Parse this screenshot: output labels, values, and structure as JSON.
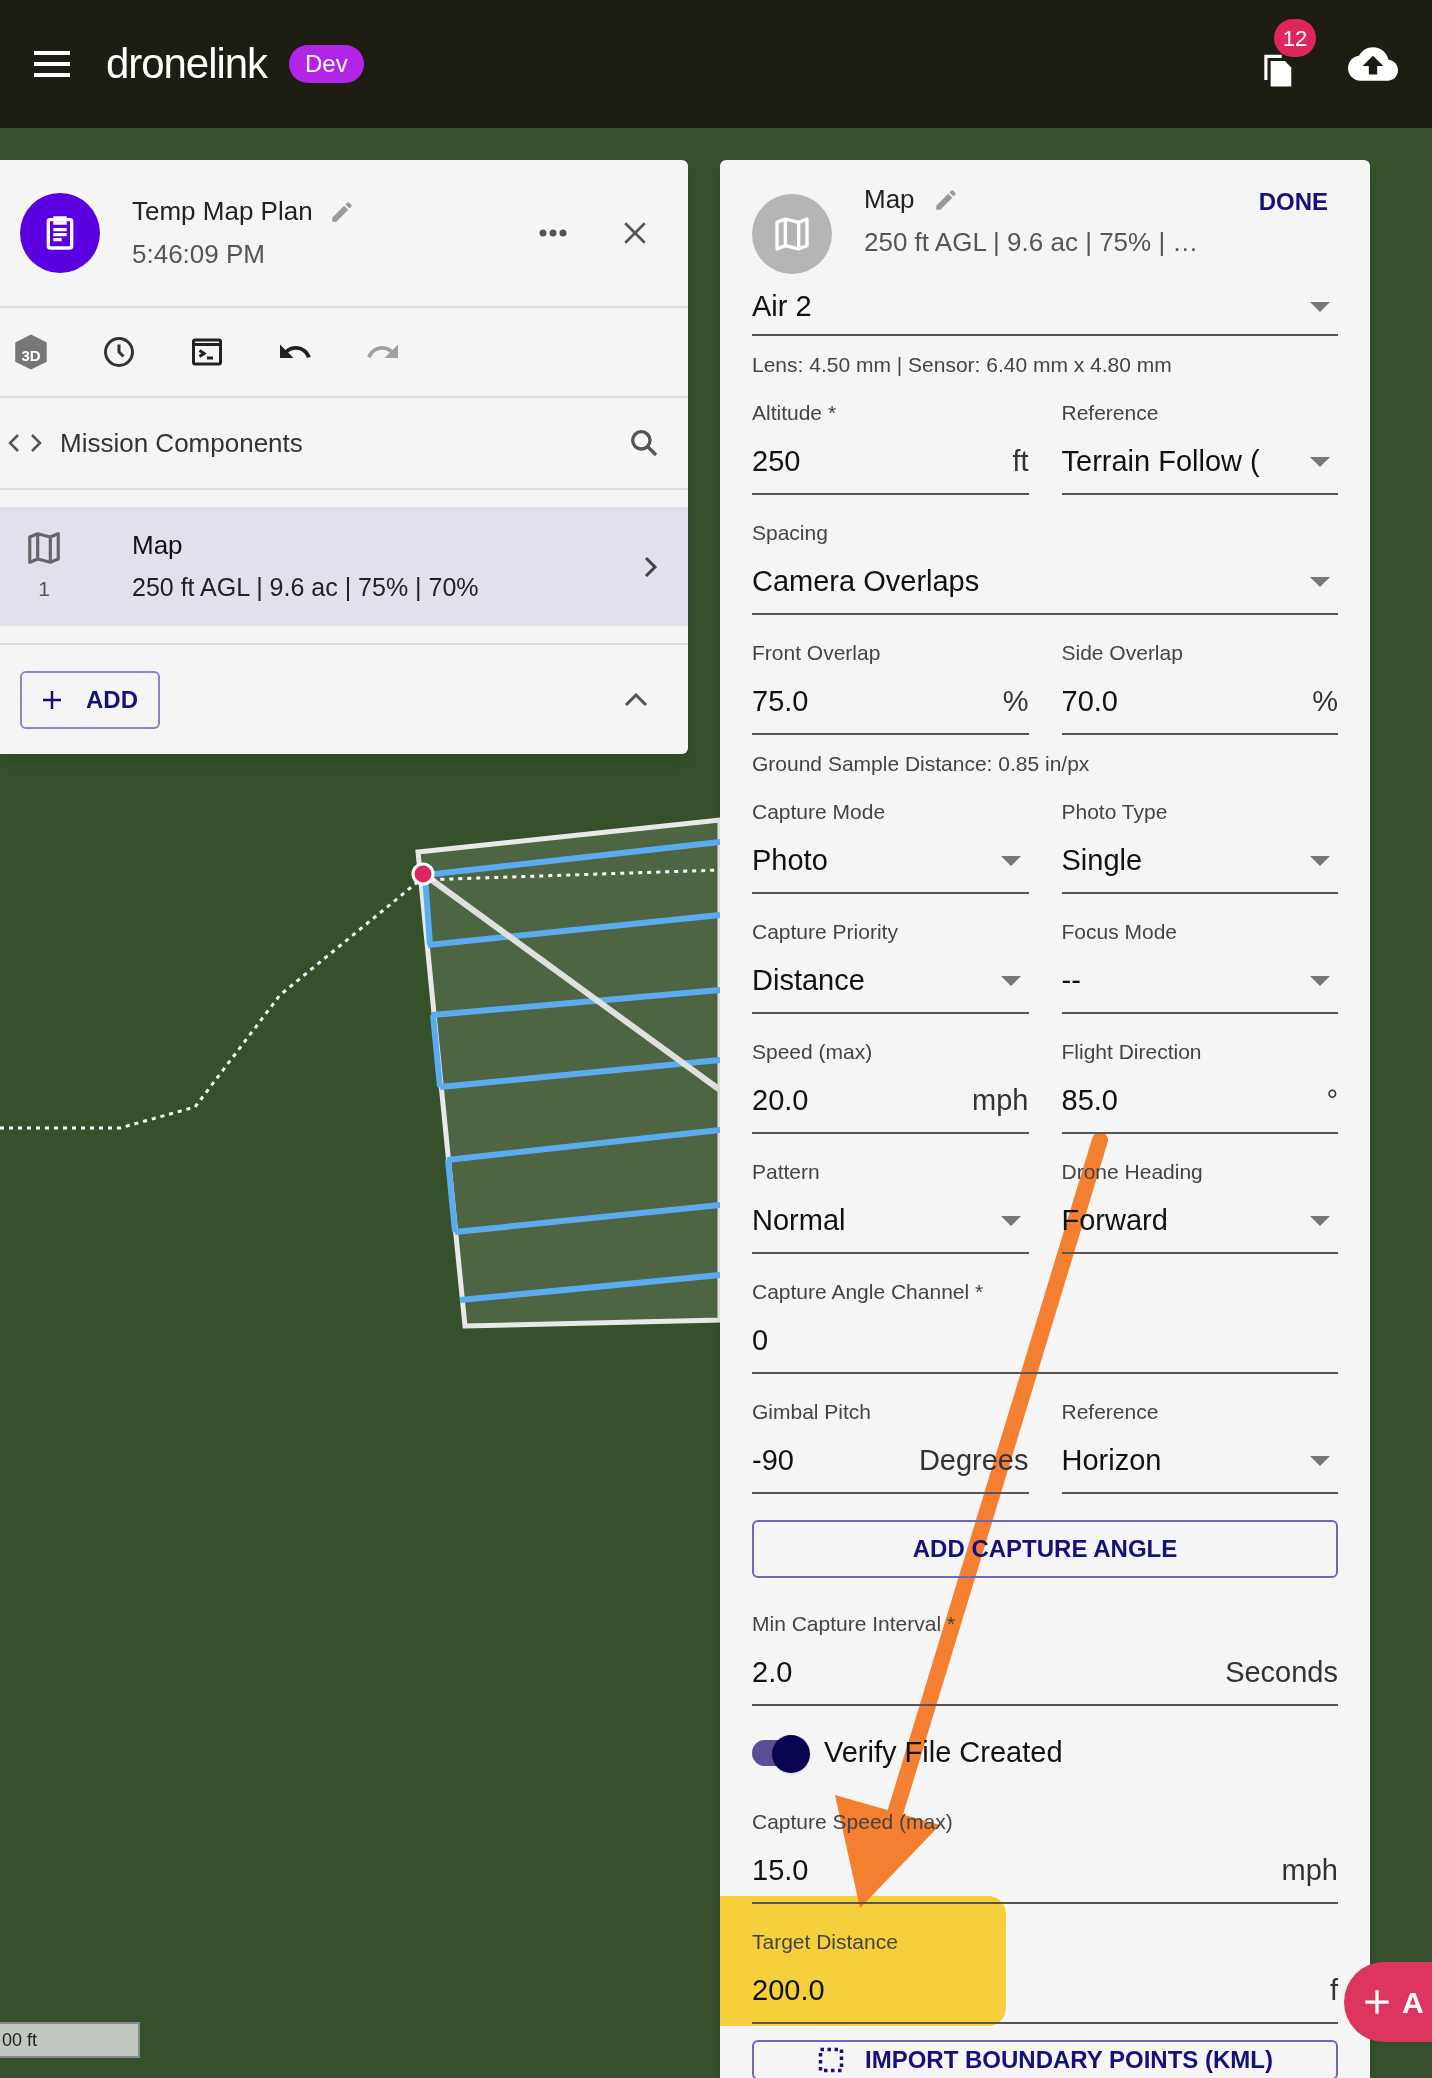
{
  "app_bar": {
    "logo": "dronelink",
    "env_badge": "Dev",
    "notification_count": "12"
  },
  "plan_panel": {
    "title": "Temp Map Plan",
    "subtitle": "5:46:09 PM",
    "toolbar": [
      {
        "kind": "cube",
        "label": "3D",
        "disabled": false
      },
      {
        "kind": "history",
        "disabled": false
      },
      {
        "kind": "console",
        "disabled": false
      },
      {
        "kind": "undo",
        "disabled": false
      },
      {
        "kind": "redo",
        "disabled": true
      }
    ],
    "section_title": "Mission Components",
    "components": [
      {
        "index": "1",
        "title": "Map",
        "summary": "250 ft AGL | 9.6 ac | 75% | 70%",
        "selected": true
      }
    ],
    "add_button": "ADD"
  },
  "component_panel": {
    "title": "Map",
    "subtitle": "250 ft AGL | 9.6 ac | 75% | …",
    "done_button": "DONE",
    "rows": [
      {
        "kind": "fields",
        "items": [
          {
            "kind": "select",
            "value": "Air 2"
          }
        ]
      },
      {
        "kind": "info",
        "text": "Lens: 4.50 mm | Sensor: 6.40 mm x 4.80 mm"
      },
      {
        "kind": "fields",
        "items": [
          {
            "kind": "input",
            "label": "Altitude *",
            "value": "250",
            "suffix": "ft"
          },
          {
            "kind": "select",
            "label": "Reference",
            "value": "Terrain Follow ("
          }
        ]
      },
      {
        "kind": "fields",
        "items": [
          {
            "kind": "select",
            "label": "Spacing",
            "value": "Camera Overlaps"
          }
        ]
      },
      {
        "kind": "fields",
        "items": [
          {
            "kind": "input",
            "label": "Front Overlap",
            "value": "75.0",
            "suffix": "%"
          },
          {
            "kind": "input",
            "label": "Side Overlap",
            "value": "70.0",
            "suffix": "%"
          }
        ]
      },
      {
        "kind": "info",
        "text": "Ground Sample Distance: 0.85 in/px"
      },
      {
        "kind": "fields",
        "items": [
          {
            "kind": "select",
            "label": "Capture Mode",
            "value": "Photo"
          },
          {
            "kind": "select",
            "label": "Photo Type",
            "value": "Single"
          }
        ]
      },
      {
        "kind": "fields",
        "items": [
          {
            "kind": "select",
            "label": "Capture Priority",
            "value": "Distance"
          },
          {
            "kind": "select",
            "label": "Focus Mode",
            "value": "--"
          }
        ]
      },
      {
        "kind": "fields",
        "items": [
          {
            "kind": "input",
            "label": "Speed (max)",
            "value": "20.0",
            "suffix": "mph"
          },
          {
            "kind": "input",
            "label": "Flight Direction",
            "value": "85.0",
            "suffix": "°"
          }
        ]
      },
      {
        "kind": "fields",
        "items": [
          {
            "kind": "select",
            "label": "Pattern",
            "value": "Normal"
          },
          {
            "kind": "select",
            "label": "Drone Heading",
            "value": "Forward"
          }
        ]
      },
      {
        "kind": "fields",
        "items": [
          {
            "kind": "input",
            "label": "Capture Angle Channel *",
            "value": "0"
          }
        ]
      },
      {
        "kind": "fields",
        "items": [
          {
            "kind": "input",
            "label": "Gimbal Pitch",
            "value": "-90",
            "suffix": "Degrees"
          },
          {
            "kind": "select",
            "label": "Reference",
            "value": "Horizon"
          }
        ]
      },
      {
        "kind": "button",
        "text": "ADD CAPTURE ANGLE"
      },
      {
        "kind": "fields",
        "items": [
          {
            "kind": "input",
            "label": "Min Capture Interval *",
            "value": "2.0",
            "suffix": "Seconds"
          }
        ]
      },
      {
        "kind": "toggle",
        "label": "Verify File Created",
        "on": true
      },
      {
        "kind": "fields",
        "items": [
          {
            "kind": "input",
            "label": "Capture Speed (max)",
            "value": "15.0",
            "suffix": "mph"
          }
        ]
      },
      {
        "kind": "fields",
        "items": [
          {
            "kind": "input",
            "label": "Target Distance",
            "value": "200.0",
            "suffix": "f"
          }
        ]
      },
      {
        "kind": "import_button",
        "text": "IMPORT BOUNDARY POINTS (KML)"
      }
    ]
  },
  "fab": {
    "label": "A"
  },
  "scale_bar": "00 ft"
}
